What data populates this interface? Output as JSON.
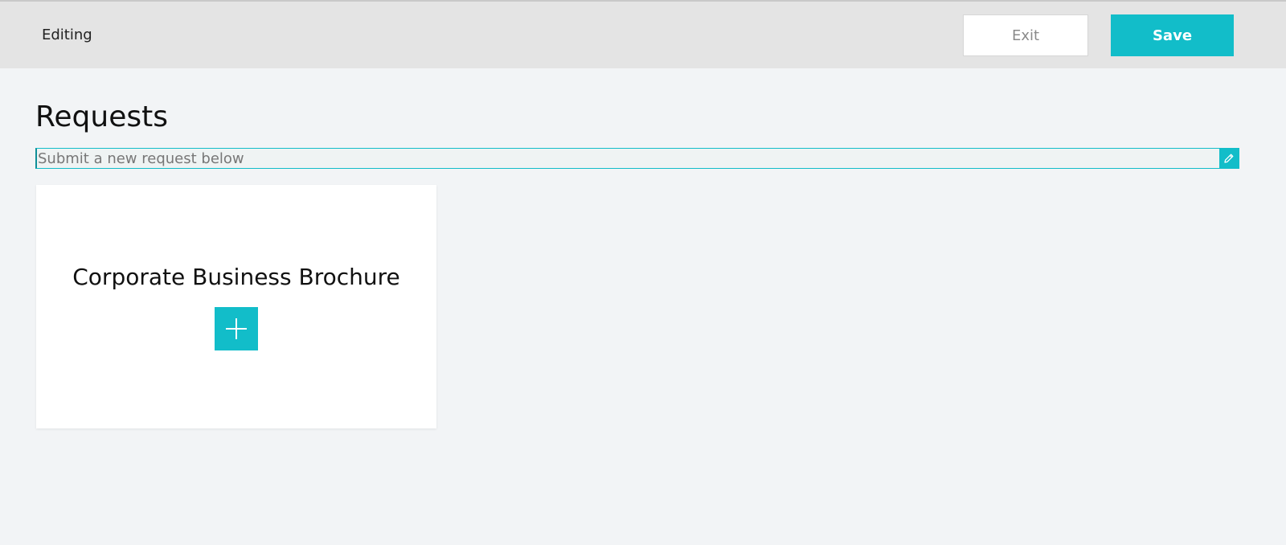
{
  "header": {
    "title": "Editing",
    "exit_label": "Exit",
    "save_label": "Save"
  },
  "main": {
    "title": "Requests",
    "description": {
      "value": "",
      "placeholder": "Submit a new request below"
    },
    "cards": [
      {
        "title": "Corporate Business Brochure"
      }
    ]
  },
  "icons": {
    "edit": "pencil-icon",
    "add": "plus-icon"
  },
  "colors": {
    "accent": "#12bdc9",
    "header_bg": "#e4e4e4",
    "page_bg": "#f2f4f6"
  }
}
